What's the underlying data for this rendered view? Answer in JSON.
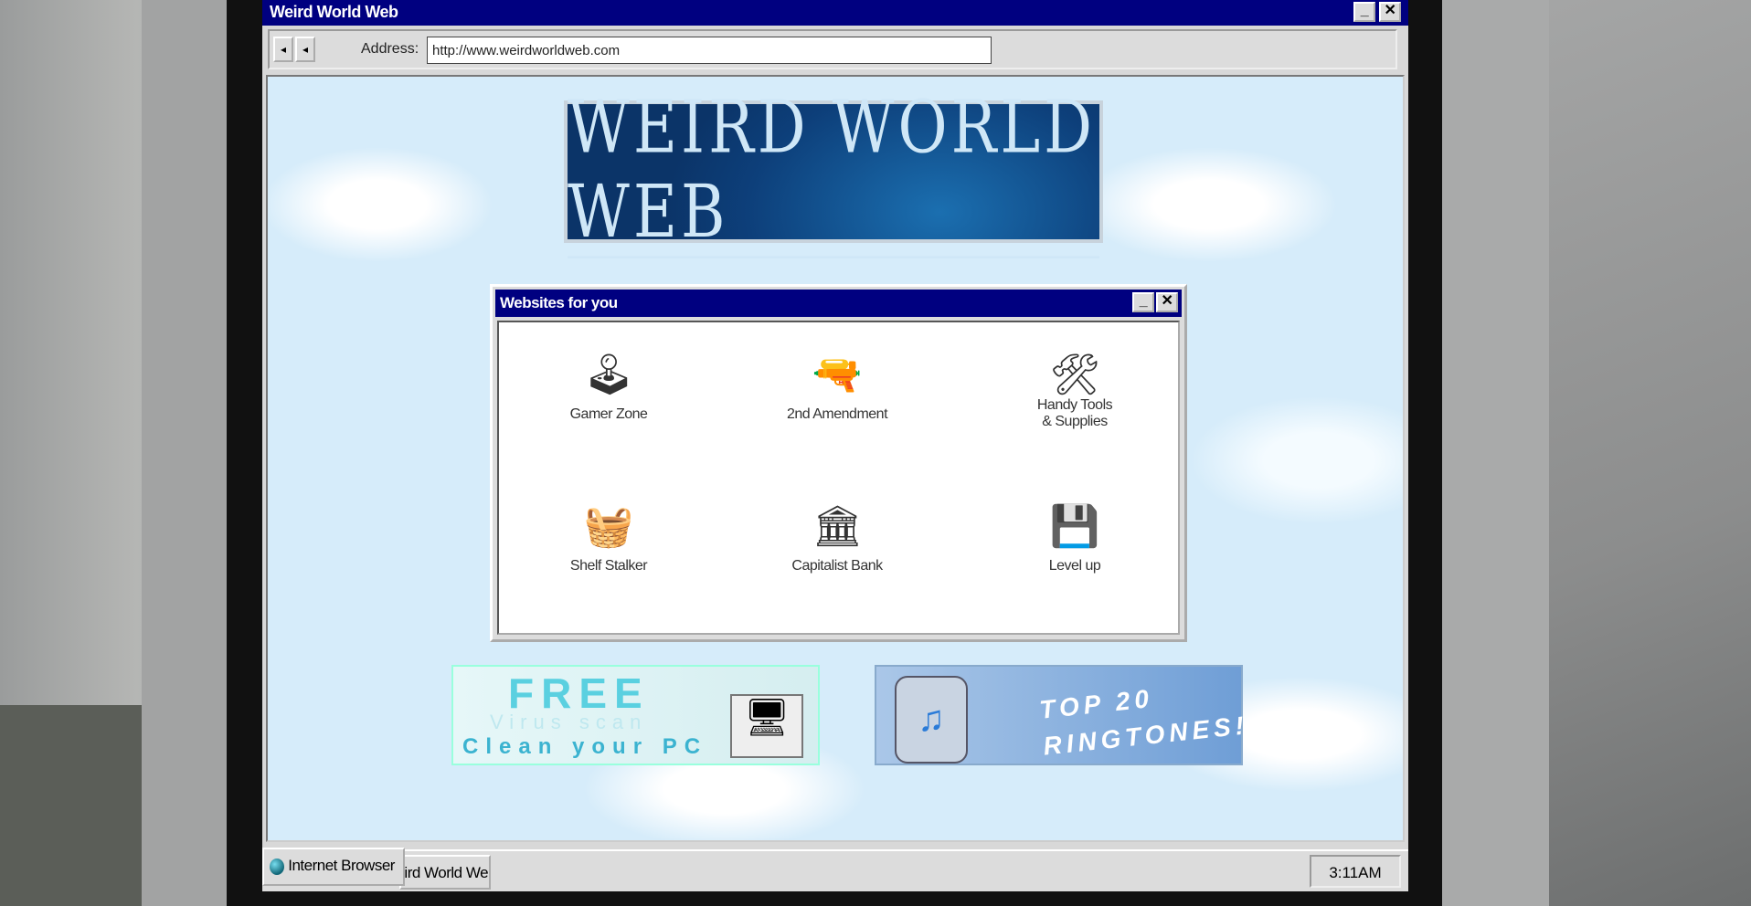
{
  "browser": {
    "title": "Weird World Web",
    "back_label": "◂",
    "forward_label": "◂",
    "address_label": "Address:",
    "address_value": "http://www.weirdworldweb.com",
    "minimize_label": "_",
    "close_label": "✕"
  },
  "page": {
    "logo_text": "WEIRD WORLD WEB",
    "dialog": {
      "title": "Websites for you",
      "minimize_label": "_",
      "close_label": "✕",
      "sites": [
        {
          "label": "Gamer Zone",
          "icon": "🕹"
        },
        {
          "label": "2nd Amendment",
          "icon": "🔫"
        },
        {
          "label": "Handy Tools & Supplies",
          "icon": "🛠"
        },
        {
          "label": "Shelf Stalker",
          "icon": "🧺"
        },
        {
          "label": "Capitalist Bank",
          "icon": "🏛"
        },
        {
          "label": "Level up",
          "icon": "💾"
        }
      ]
    },
    "ads": {
      "virus": {
        "line1": "FREE",
        "line2": "Virus scan",
        "line3": "Clean your PC"
      },
      "ringtones": {
        "line1": "TOP 20",
        "line2": "RINGTONES!"
      }
    }
  },
  "taskbar": {
    "start_label": "Internet Browser",
    "window_label": "Weird World Web",
    "clock": "3:11AM"
  }
}
